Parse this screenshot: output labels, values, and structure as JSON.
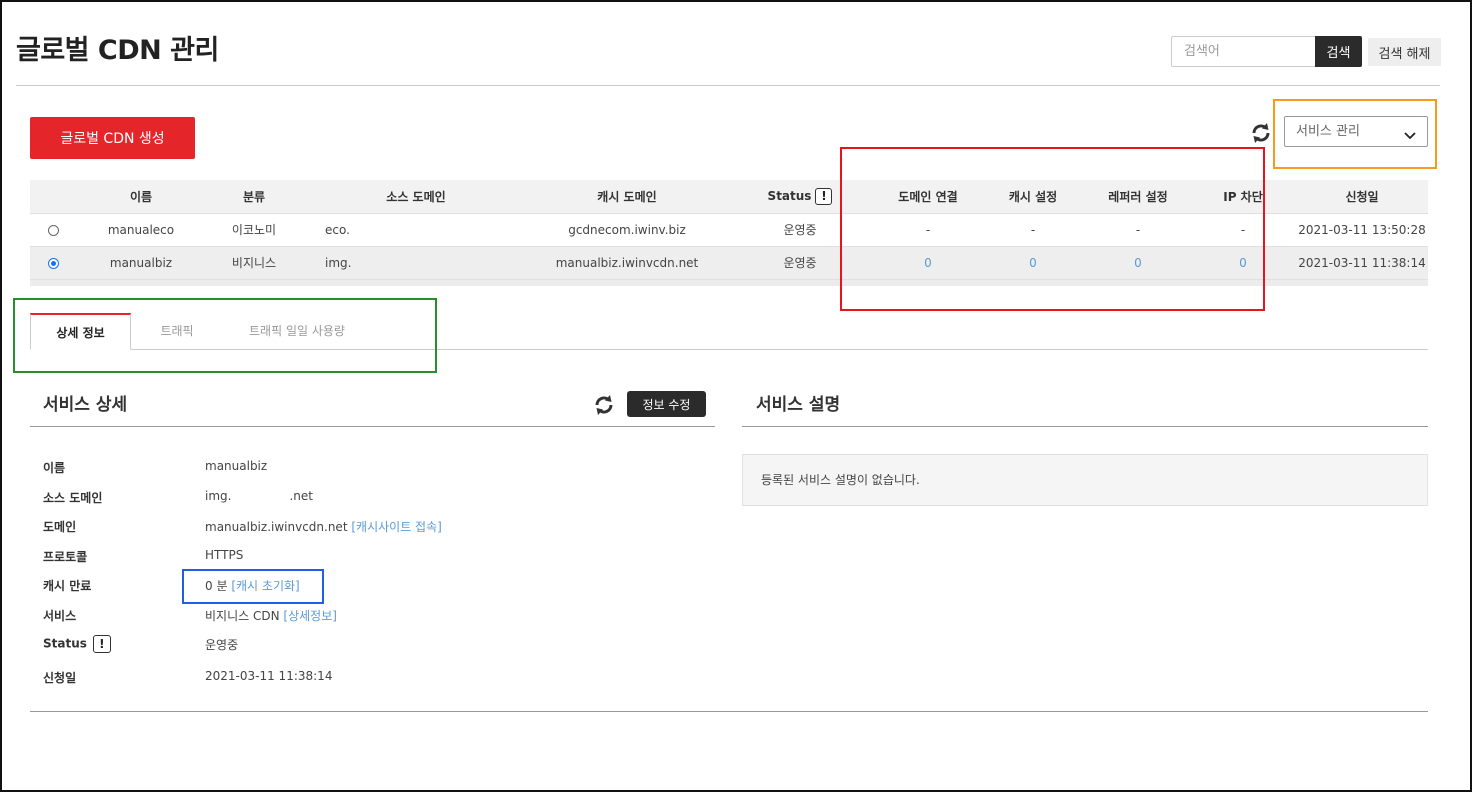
{
  "colors": {
    "accent_red": "#e4262b",
    "link_blue": "#5b9bd5",
    "dark_button": "#2b2b2b",
    "annotation_red": "#e8141b",
    "annotation_orange": "#f39c1f",
    "annotation_green": "#2a8c2a",
    "annotation_blue": "#1f5fe0"
  },
  "header": {
    "title": "글로벌 CDN 관리",
    "search_placeholder": "검색어",
    "search_value": "",
    "search_button": "검색",
    "search_clear_button": "검색 해제"
  },
  "toolbar": {
    "create_button": "글로벌 CDN 생성",
    "refresh_icon": "refresh-icon",
    "service_select": {
      "selected": "서비스 관리",
      "icon": "chevron-down-icon"
    }
  },
  "table": {
    "headers": [
      "",
      "이름",
      "분류",
      "소스 도메인",
      "캐시 도메인",
      "Status",
      "도메인 연결",
      "캐시 설정",
      "레퍼러 설정",
      "IP 차단",
      "신청일"
    ],
    "status_help_symbol": "!",
    "rows": [
      {
        "selected": false,
        "name": "manualeco",
        "category": "이코노미",
        "source_domain": "eco.",
        "cache_domain": "gcdnecom.iwinv.biz",
        "status": "운영중",
        "domain_link": "-",
        "cache_setting": "-",
        "referer_setting": "-",
        "ip_block": "-",
        "date": "2021-03-11 13:50:28"
      },
      {
        "selected": true,
        "name": "manualbiz",
        "category": "비지니스",
        "source_domain": "img.",
        "cache_domain": "manualbiz.iwinvcdn.net",
        "status": "운영중",
        "domain_link": "0",
        "cache_setting": "0",
        "referer_setting": "0",
        "ip_block": "0",
        "date": "2021-03-11 11:38:14"
      }
    ]
  },
  "tabs": [
    {
      "label": "상세 정보",
      "active": true
    },
    {
      "label": "트래픽",
      "active": false
    },
    {
      "label": "트래픽 일일 사용량",
      "active": false
    }
  ],
  "detail": {
    "title": "서비스 상세",
    "edit_button": "정보 수정",
    "labels": {
      "name": "이름",
      "source_domain": "소스 도메인",
      "domain": "도메인",
      "protocol": "프로토콜",
      "cache_expire": "캐시 만료",
      "service": "서비스",
      "status": "Status",
      "date": "신청일"
    },
    "values": {
      "name": "manualbiz",
      "source_domain_prefix": "img.",
      "source_domain_suffix": ".net",
      "domain": "manualbiz.iwinvcdn.net",
      "domain_link": "[캐시사이트 접속]",
      "protocol": "HTTPS",
      "cache_expire": "0 분",
      "cache_reset_link": "[캐시 초기화]",
      "service": "비지니스 CDN",
      "service_link": "[상세정보]",
      "status": "운영중",
      "date": "2021-03-11 11:38:14"
    },
    "status_help_symbol": "!"
  },
  "description": {
    "title": "서비스 설명",
    "text": "등록된 서비스 설명이 없습니다."
  }
}
